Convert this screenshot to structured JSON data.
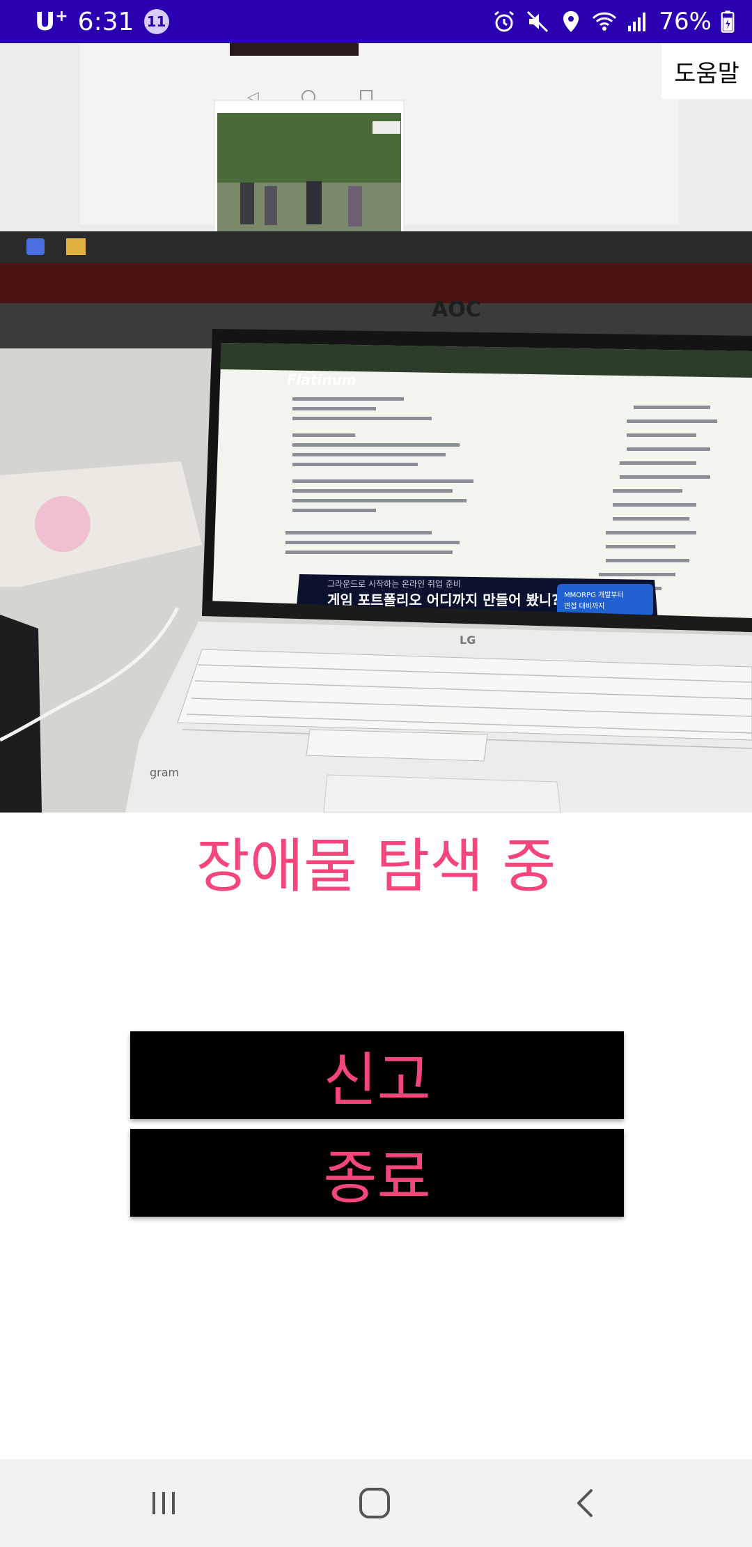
{
  "status_bar": {
    "carrier": "U",
    "carrier_suffix": "+",
    "time": "6:31",
    "notification_count": "11",
    "battery": "76%",
    "icons": [
      "alarm-icon",
      "mute-icon",
      "location-icon",
      "wifi-icon",
      "signal-icon",
      "battery-icon"
    ]
  },
  "camera": {
    "help_label": "도움말",
    "ad_line_small": "그라운드로 시작하는 온라인 취업 준비",
    "ad_line_main": "게임 포트폴리오 어디까지 만들어 봤니?",
    "ad_cta_1": "MMORPG 개발부터",
    "ad_cta_2": "면접 대비까지",
    "monitor_brand": "AOC",
    "laptop_brand": "LG",
    "blog_name": "Flatinum",
    "keyboard_brand": "gram"
  },
  "main": {
    "status_message": "장애물 탐색 중",
    "report_label": "신고",
    "exit_label": "종료"
  },
  "nav": {
    "icons": [
      "recents-icon",
      "home-icon",
      "back-icon"
    ]
  },
  "colors": {
    "status_bar": "#2b00b0",
    "accent": "#f4467a",
    "button_bg": "#000000",
    "nav_bar": "#f2f2f2"
  }
}
